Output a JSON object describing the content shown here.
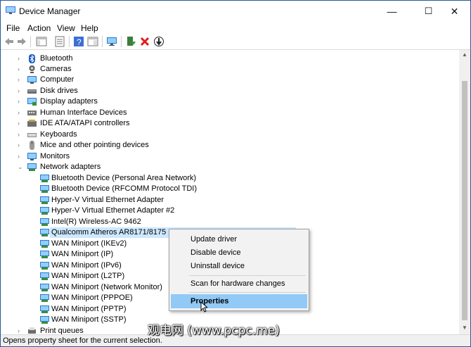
{
  "window": {
    "title": "Device Manager"
  },
  "title_buttons": {
    "minimize": "—",
    "maximize": "☐",
    "close": "✕"
  },
  "menu": [
    "File",
    "Action",
    "View",
    "Help"
  ],
  "toolbar_icons": [
    "back-arrow-icon",
    "forward-arrow-icon",
    "show-hide-tree-icon",
    "properties-icon",
    "help-icon",
    "action-pane-icon",
    "monitor-icon",
    "update-driver-icon",
    "uninstall-icon",
    "disable-icon"
  ],
  "tree": {
    "categories": [
      {
        "label": "Bluetooth",
        "icon": "bluetooth-icon"
      },
      {
        "label": "Cameras",
        "icon": "camera-icon"
      },
      {
        "label": "Computer",
        "icon": "computer-icon"
      },
      {
        "label": "Disk drives",
        "icon": "disk-drive-icon"
      },
      {
        "label": "Display adapters",
        "icon": "display-adapter-icon"
      },
      {
        "label": "Human Interface Devices",
        "icon": "hid-icon"
      },
      {
        "label": "IDE ATA/ATAPI controllers",
        "icon": "ide-controller-icon"
      },
      {
        "label": "Keyboards",
        "icon": "keyboard-icon"
      },
      {
        "label": "Mice and other pointing devices",
        "icon": "mouse-icon"
      },
      {
        "label": "Monitors",
        "icon": "monitor-icon"
      },
      {
        "label": "Network adapters",
        "icon": "network-adapter-icon"
      }
    ],
    "network_children": [
      "Bluetooth Device (Personal Area Network)",
      "Bluetooth Device (RFCOMM Protocol TDI)",
      "Hyper-V Virtual Ethernet Adapter",
      "Hyper-V Virtual Ethernet Adapter #2",
      "Intel(R) Wireless-AC 9462",
      "Qualcomm Atheros AR8171/8175 PCI-E",
      "WAN Miniport (IKEv2)",
      "WAN Miniport (IP)",
      "WAN Miniport (IPv6)",
      "WAN Miniport (L2TP)",
      "WAN Miniport (Network Monitor)",
      "WAN Miniport (PPPOE)",
      "WAN Miniport (PPTP)",
      "WAN Miniport (SSTP)"
    ],
    "partial_next": "Print queues"
  },
  "context_menu": {
    "items": [
      "Update driver",
      "Disable device",
      "Uninstall device",
      "Scan for hardware changes",
      "Properties"
    ],
    "highlighted": "Properties"
  },
  "status": "Opens property sheet for the current selection.",
  "watermark": "观电网 (www.pcpc.me)"
}
